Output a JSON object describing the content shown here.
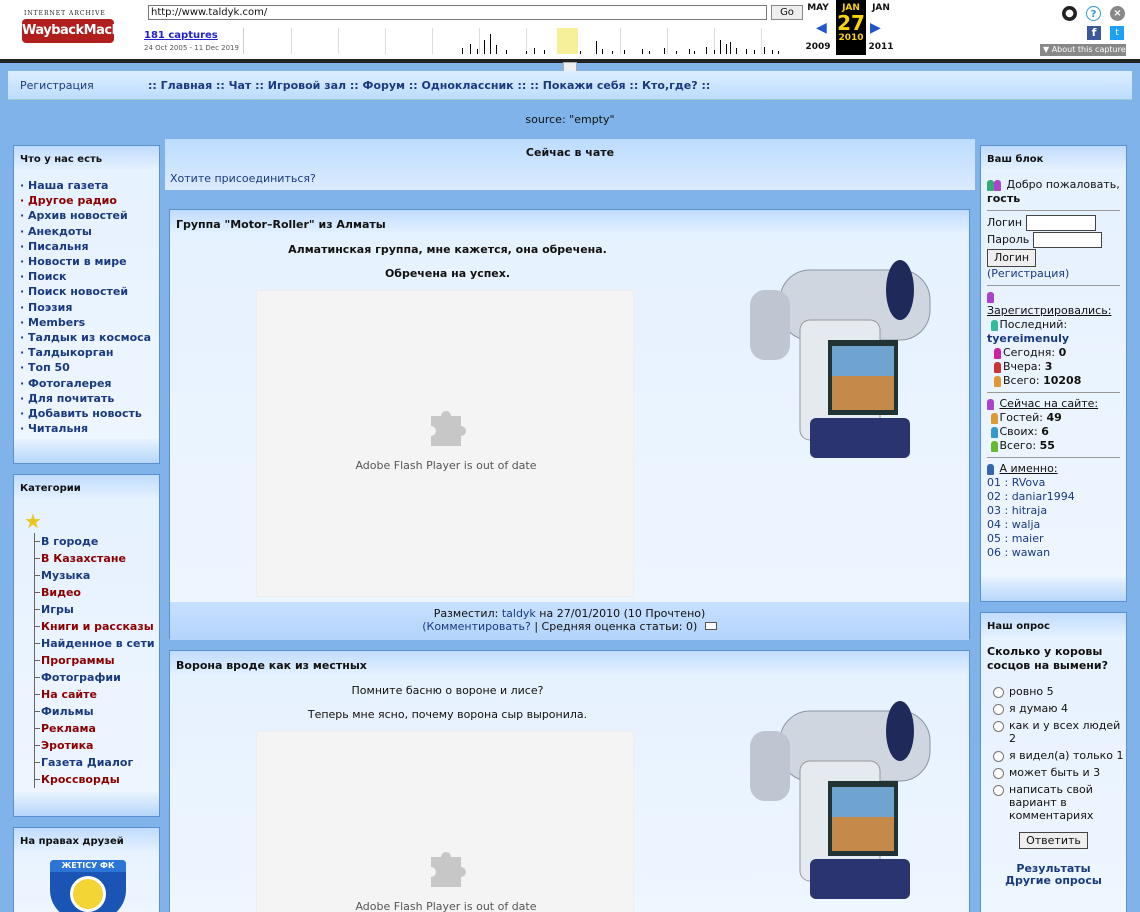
{
  "wayback": {
    "logo_top": "INTERNET ARCHIVE",
    "logo_main": "WaybackMachine",
    "url": "http://www.taldyk.com/",
    "go_label": "Go",
    "captures": "181 captures",
    "range": "24 Oct 2005 - 11 Dec 2019",
    "prev_month": "MAY",
    "cur_month": "JAN",
    "next_month": "JAN",
    "cur_day": "27",
    "prev_year": "2009",
    "cur_year": "2010",
    "next_year": "2011",
    "about": "About this capture"
  },
  "nav": {
    "register": "Регистрация",
    "links": ":: Главная :: Чат :: Игровой зал :: Форум :: Одноклассник :: :: Покажи себя :: Кто,где? ::"
  },
  "source_text": "source: \"empty\"",
  "left": {
    "what_title": "Что у нас есть",
    "what_items": [
      {
        "label": "· Наша газета",
        "color": "blue"
      },
      {
        "label": "· Другое радио",
        "color": "red"
      },
      {
        "label": "· Архив новостей",
        "color": "blue"
      },
      {
        "label": "· Анекдоты",
        "color": "blue"
      },
      {
        "label": "· Писальня",
        "color": "blue"
      },
      {
        "label": "· Новости в мире",
        "color": "blue"
      },
      {
        "label": "· Поиск",
        "color": "blue"
      },
      {
        "label": "· Поиск новостей",
        "color": "blue"
      },
      {
        "label": "· Поэзия",
        "color": "blue"
      },
      {
        "label": "· Members",
        "color": "blue"
      },
      {
        "label": "· Талдык из космоса",
        "color": "blue"
      },
      {
        "label": "· Талдыкорган",
        "color": "blue"
      },
      {
        "label": "· Топ 50",
        "color": "blue"
      },
      {
        "label": "· Фотогалерея",
        "color": "blue"
      },
      {
        "label": "· Для почитать",
        "color": "blue"
      },
      {
        "label": "· Добавить новость",
        "color": "blue"
      },
      {
        "label": "· Читальня",
        "color": "blue"
      }
    ],
    "cat_title": "Категории",
    "cats": [
      {
        "label": "В городе",
        "color": "blue"
      },
      {
        "label": "В Казахстане",
        "color": "red"
      },
      {
        "label": "Музыка",
        "color": "blue"
      },
      {
        "label": "Видео",
        "color": "red"
      },
      {
        "label": "Игры",
        "color": "blue"
      },
      {
        "label": "Книги и рассказы",
        "color": "red"
      },
      {
        "label": "Найденное в сети",
        "color": "blue"
      },
      {
        "label": "Программы",
        "color": "red"
      },
      {
        "label": "Фотографии",
        "color": "blue"
      },
      {
        "label": "На сайте",
        "color": "red"
      },
      {
        "label": "Фильмы",
        "color": "blue"
      },
      {
        "label": "Реклама",
        "color": "red"
      },
      {
        "label": "Эротика",
        "color": "red"
      },
      {
        "label": "Газета Диалог",
        "color": "blue"
      },
      {
        "label": "Кроссворды",
        "color": "red"
      }
    ],
    "friends_title": "На правах друзей",
    "friends_logo": "ЖЕТІСУ ФК"
  },
  "chat": {
    "title": "Сейчас в чате",
    "text": "Хотите присоединиться?"
  },
  "articles": [
    {
      "title": "Группа \"Motor–Roller\" из Алматы",
      "line1": "Алматинская группа, мне кажется, она обречена.",
      "line2": "Обречена на успех.",
      "flash_msg": "Adobe Flash Player is out of date",
      "posted_prefix": "Разместил: ",
      "author": "taldyk",
      "posted_suffix": " на 27/01/2010 (10 Прочтено)",
      "comment": "(Комментировать?",
      "rating": " | Средняя оценка статьи: 0)"
    },
    {
      "title": "Ворона вроде как из местных",
      "line1": "Помните басню о вороне и лисе?",
      "line2": "Теперь мне ясно, почему ворона сыр выронила.",
      "flash_msg": "Adobe Flash Player is out of date"
    }
  ],
  "right": {
    "block_title": "Ваш блок",
    "welcome": "Добро пожаловать,",
    "guest": "гость",
    "login_label": "Логин",
    "pass_label": "Пароль",
    "login_btn": "Логин",
    "register_link": "(Регистрация)",
    "registered": "Зарегистрировались:",
    "last_label": "Последний:",
    "last_user": "tyereimenuly",
    "today_label": "Сегодня:",
    "today": "0",
    "yesterday_label": "Вчера:",
    "yesterday": "3",
    "total_label": "Всего:",
    "total": "10208",
    "online": "Сейчас на сайте:",
    "guests_label": "Гостей:",
    "guests": "49",
    "own_label": "Своих:",
    "own": "6",
    "online_total_label": "Всего:",
    "online_total": "55",
    "who": "А именно:",
    "users": [
      "01 : RVova",
      "02 : daniar1994",
      "03 : hitraja",
      "04 : walja",
      "05 : maier",
      "06 : wawan"
    ],
    "poll_title": "Наш опрос",
    "poll_q": "Сколько у коровы сосцов на вымени?",
    "poll_opts": [
      "ровно 5",
      "я думаю 4",
      "как и у всех людей 2",
      "я видел(а) только 1",
      "может быть и 3",
      "написать свой вариант в комментариях"
    ],
    "vote_btn": "Ответить",
    "results": "Результаты",
    "other_polls": "Другие опросы"
  }
}
